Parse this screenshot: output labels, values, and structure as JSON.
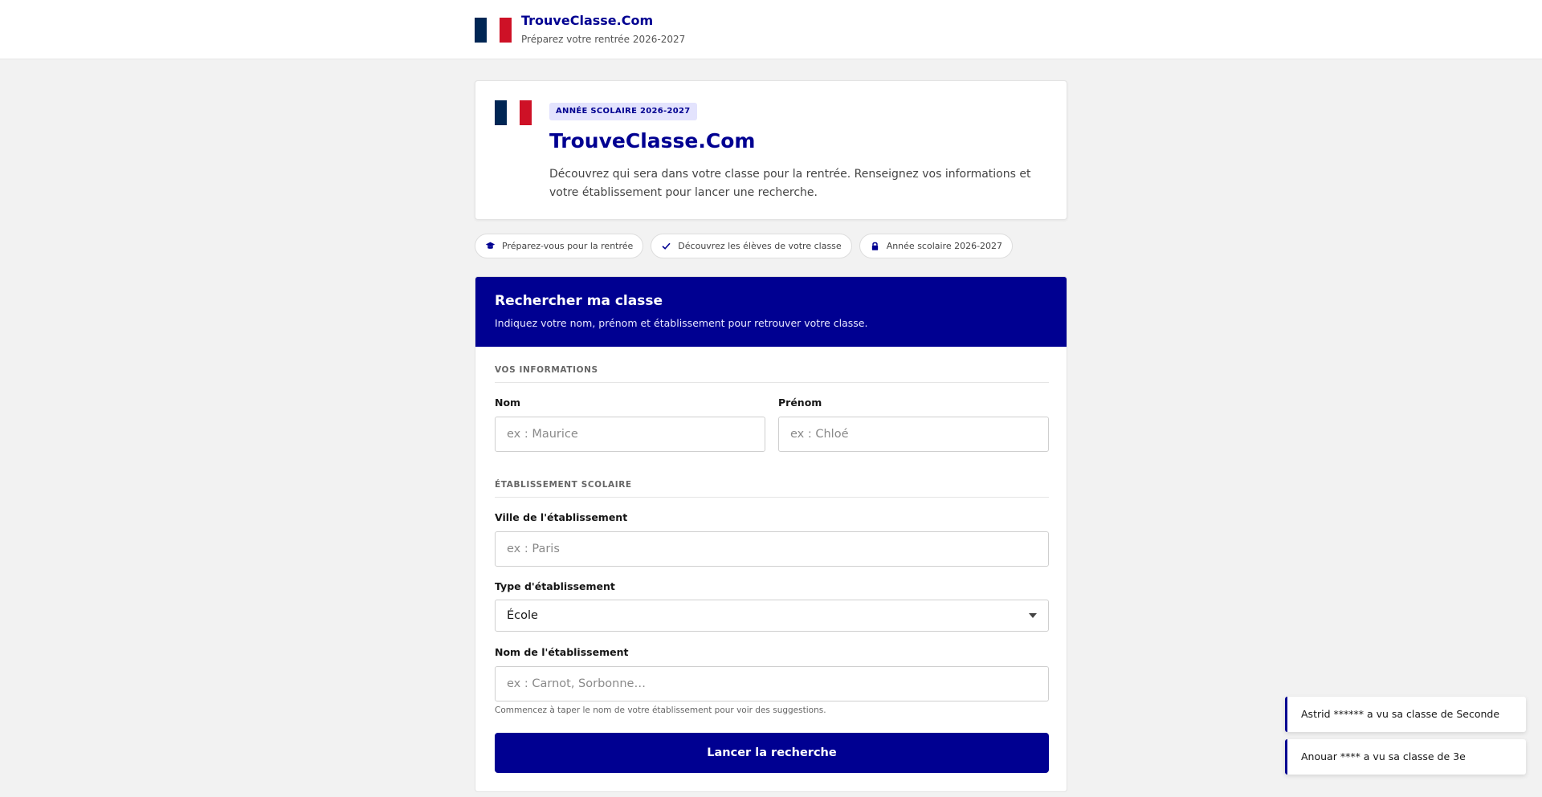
{
  "header": {
    "title": "TrouveClasse.Com",
    "subtitle": "Préparez votre rentrée 2026-2027"
  },
  "hero": {
    "badge": "ANNÉE SCOLAIRE 2026-2027",
    "title": "TrouveClasse.Com",
    "description": "Découvrez qui sera dans votre classe pour la rentrée. Renseignez vos informations et votre établissement pour lancer une recherche."
  },
  "chips": [
    {
      "icon": "graduation-cap-icon",
      "label": "Préparez-vous pour la rentrée"
    },
    {
      "icon": "check-icon",
      "label": "Découvrez les élèves de votre classe"
    },
    {
      "icon": "lock-icon",
      "label": "Année scolaire 2026-2027"
    }
  ],
  "search": {
    "title": "Rechercher ma classe",
    "subtitle": "Indiquez votre nom, prénom et établissement pour retrouver votre classe.",
    "section_info": "VOS INFORMATIONS",
    "nom": {
      "label": "Nom",
      "placeholder": "ex : Maurice",
      "value": ""
    },
    "prenom": {
      "label": "Prénom",
      "placeholder": "ex : Chloé",
      "value": ""
    },
    "section_school": "ÉTABLISSEMENT SCOLAIRE",
    "ville": {
      "label": "Ville de l'établissement",
      "placeholder": "ex : Paris",
      "value": ""
    },
    "type": {
      "label": "Type d'établissement",
      "selected": "École"
    },
    "etablissement": {
      "label": "Nom de l'établissement",
      "placeholder": "ex : Carnot, Sorbonne…",
      "value": ""
    },
    "hint": "Commencez à taper le nom de votre établissement pour voir des suggestions.",
    "button": "Lancer la recherche"
  },
  "toasts": [
    "Astrid ****** a vu sa classe de Seconde",
    "Anouar **** a vu sa classe de 3e"
  ],
  "colors": {
    "primary": "#000091",
    "flag_blue": "#002654",
    "flag_red": "#ce1126",
    "background": "#f2f2f2"
  }
}
